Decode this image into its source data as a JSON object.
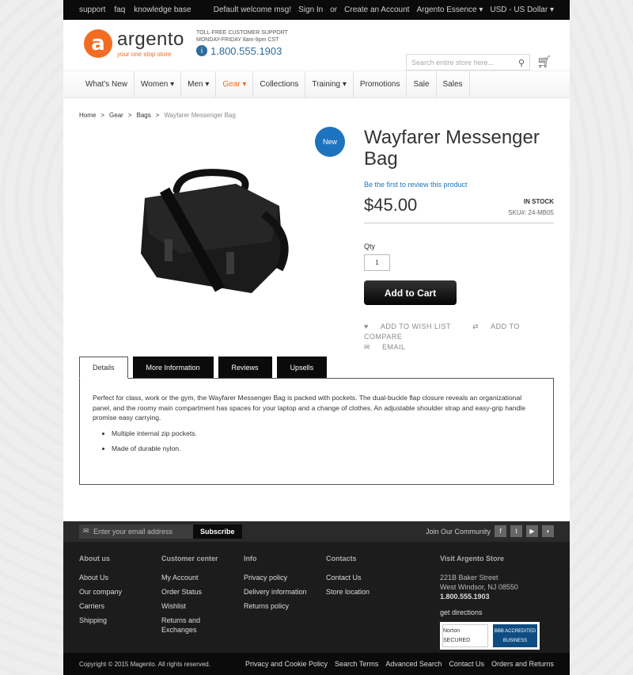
{
  "topbar": {
    "left_links": [
      "support",
      "faq",
      "knowledge base"
    ],
    "welcome": "Default welcome msg!",
    "sign_in": "Sign In",
    "or": "or",
    "create_account": "Create an Account",
    "store": "Argento Essence ▾",
    "currency": "USD - US Dollar ▾"
  },
  "header": {
    "logo_mark": "a",
    "logo_name": "argento",
    "logo_tagline": "your one stop store",
    "support_line1": "TOLL-FREE CUSTOMER SUPPORT",
    "support_line2": "MONDAY-FRIDAY 8am-9pm CST",
    "support_phone": "1.800.555.1903",
    "search_placeholder": "Search entire store here...",
    "info_glyph": "i"
  },
  "nav": {
    "items": [
      {
        "label": "What's New"
      },
      {
        "label": "Women ▾"
      },
      {
        "label": "Men ▾"
      },
      {
        "label": "Gear ▾"
      },
      {
        "label": "Collections"
      },
      {
        "label": "Training ▾"
      },
      {
        "label": "Promotions"
      },
      {
        "label": "Sale"
      },
      {
        "label": "Sales"
      }
    ],
    "active_index": 3
  },
  "breadcrumb": {
    "items": [
      "Home",
      "Gear",
      "Bags"
    ],
    "current": "Wayfarer Messenger Bag",
    "separator": ">"
  },
  "product": {
    "badge": "New",
    "title": "Wayfarer Messenger Bag",
    "review_link": "Be the first to review this product",
    "price": "$45.00",
    "stock": "IN STOCK",
    "sku_label": "SKU#:",
    "sku": "24-MB05",
    "qty_label": "Qty",
    "qty_value": "1",
    "add_to_cart": "Add to Cart",
    "wish": "ADD TO WISH LIST",
    "compare": "ADD TO COMPARE",
    "email": "EMAIL"
  },
  "tabs": {
    "items": [
      "Details",
      "More Information",
      "Reviews",
      "Upsells"
    ],
    "active": "Details",
    "details_text": "Perfect for class, work or the gym, the Wayfarer Messenger Bag is packed with pockets. The dual-buckle flap closure reveals an organizational panel, and the roomy main compartment has spaces for your laptop and a change of clothes. An adjustable shoulder strap and easy-grip handle promise easy carrying.",
    "bullets": [
      "Multiple internal zip pockets.",
      "Made of durable nylon."
    ]
  },
  "newsletter": {
    "placeholder": "Enter your email address",
    "button": "Subscribe",
    "community": "Join Our Community",
    "social_glyphs": [
      "f",
      "t",
      "▶",
      "◗"
    ]
  },
  "footer": {
    "about": {
      "title": "About us",
      "links": [
        "About Us",
        "Our company",
        "Carriers",
        "Shipping"
      ]
    },
    "customer": {
      "title": "Customer center",
      "links": [
        "My Account",
        "Order Status",
        "Wishlist",
        "Returns and Exchanges"
      ]
    },
    "info": {
      "title": "Info",
      "links": [
        "Privacy policy",
        "Delivery information",
        "Returns policy"
      ]
    },
    "contacts": {
      "title": "Contacts",
      "links": [
        "Contact Us",
        "Store location"
      ]
    },
    "visit": {
      "title": "Visit Argento Store",
      "address1": "221B Baker Street",
      "address2": "West Windsor, NJ 08550",
      "phone": "1.800.555.1903",
      "directions": "get directions",
      "norton": "Norton SECURED",
      "bbb": "BBB ACCREDITED BUSINESS"
    }
  },
  "copyright": {
    "text": "Copyright © 2015 Magento. All rights reserved.",
    "links": [
      "Privacy and Cookie Policy",
      "Search Terms",
      "Advanced Search",
      "Contact Us",
      "Orders and Returns"
    ]
  }
}
